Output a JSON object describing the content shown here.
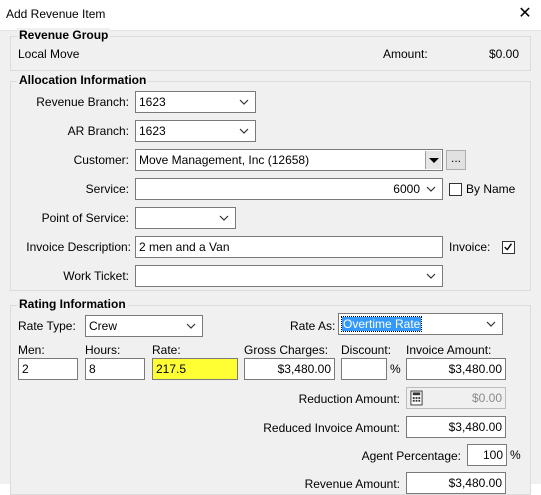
{
  "window": {
    "title": "Add Revenue Item",
    "close_glyph": "✕"
  },
  "revenue_group": {
    "title": "Revenue Group",
    "name": "Local Move",
    "amount_label": "Amount:",
    "amount_value": "$0.00"
  },
  "allocation": {
    "title": "Allocation Information",
    "revenue_branch_label": "Revenue Branch:",
    "revenue_branch_value": "1623",
    "ar_branch_label": "AR Branch:",
    "ar_branch_value": "1623",
    "customer_label": "Customer:",
    "customer_value": "Move Management, Inc (12658)",
    "customer_more": "...",
    "service_label": "Service:",
    "service_value": "6000",
    "by_name_label": "By Name",
    "point_of_service_label": "Point of Service:",
    "point_of_service_value": "",
    "invoice_description_label": "Invoice Description:",
    "invoice_description_value": "2 men and a Van",
    "invoice_label": "Invoice:",
    "invoice_checked": true,
    "work_ticket_label": "Work Ticket:",
    "work_ticket_value": ""
  },
  "rating": {
    "title": "Rating Information",
    "rate_type_label": "Rate Type:",
    "rate_type_value": "Crew",
    "rate_as_label": "Rate As:",
    "rate_as_value": "Overtime Rate",
    "men_label": "Men:",
    "men_value": "2",
    "hours_label": "Hours:",
    "hours_value": "8",
    "rate_label": "Rate:",
    "rate_value": "217.5",
    "gross_charges_label": "Gross Charges:",
    "gross_charges_value": "$3,480.00",
    "discount_label": "Discount:",
    "discount_value": "",
    "percent_symbol": "%",
    "invoice_amount_label": "Invoice Amount:",
    "invoice_amount_value": "$3,480.00",
    "reduction_amount_label": "Reduction Amount:",
    "reduction_amount_value": "$0.00",
    "reduced_invoice_amount_label": "Reduced Invoice Amount:",
    "reduced_invoice_amount_value": "$3,480.00",
    "agent_percentage_label": "Agent Percentage:",
    "agent_percentage_value": "100",
    "agent_percent_symbol": "%",
    "revenue_amount_label": "Revenue Amount:",
    "revenue_amount_value": "$3,480.00"
  }
}
